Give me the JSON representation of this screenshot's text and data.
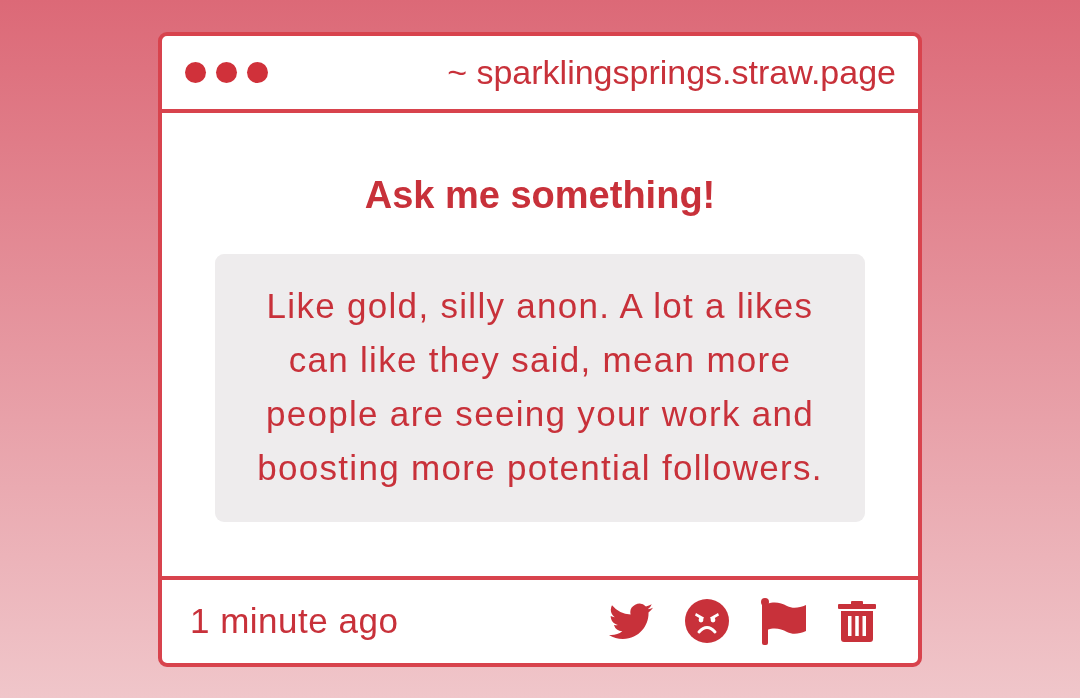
{
  "window": {
    "address": "~ sparklingsprings.straw.page"
  },
  "title": "Ask me something!",
  "answer": "Like gold, silly anon. A lot a likes can like they said, mean more people are seeing your work and boosting more potential followers.",
  "footer": {
    "time": "1 minute ago"
  }
}
